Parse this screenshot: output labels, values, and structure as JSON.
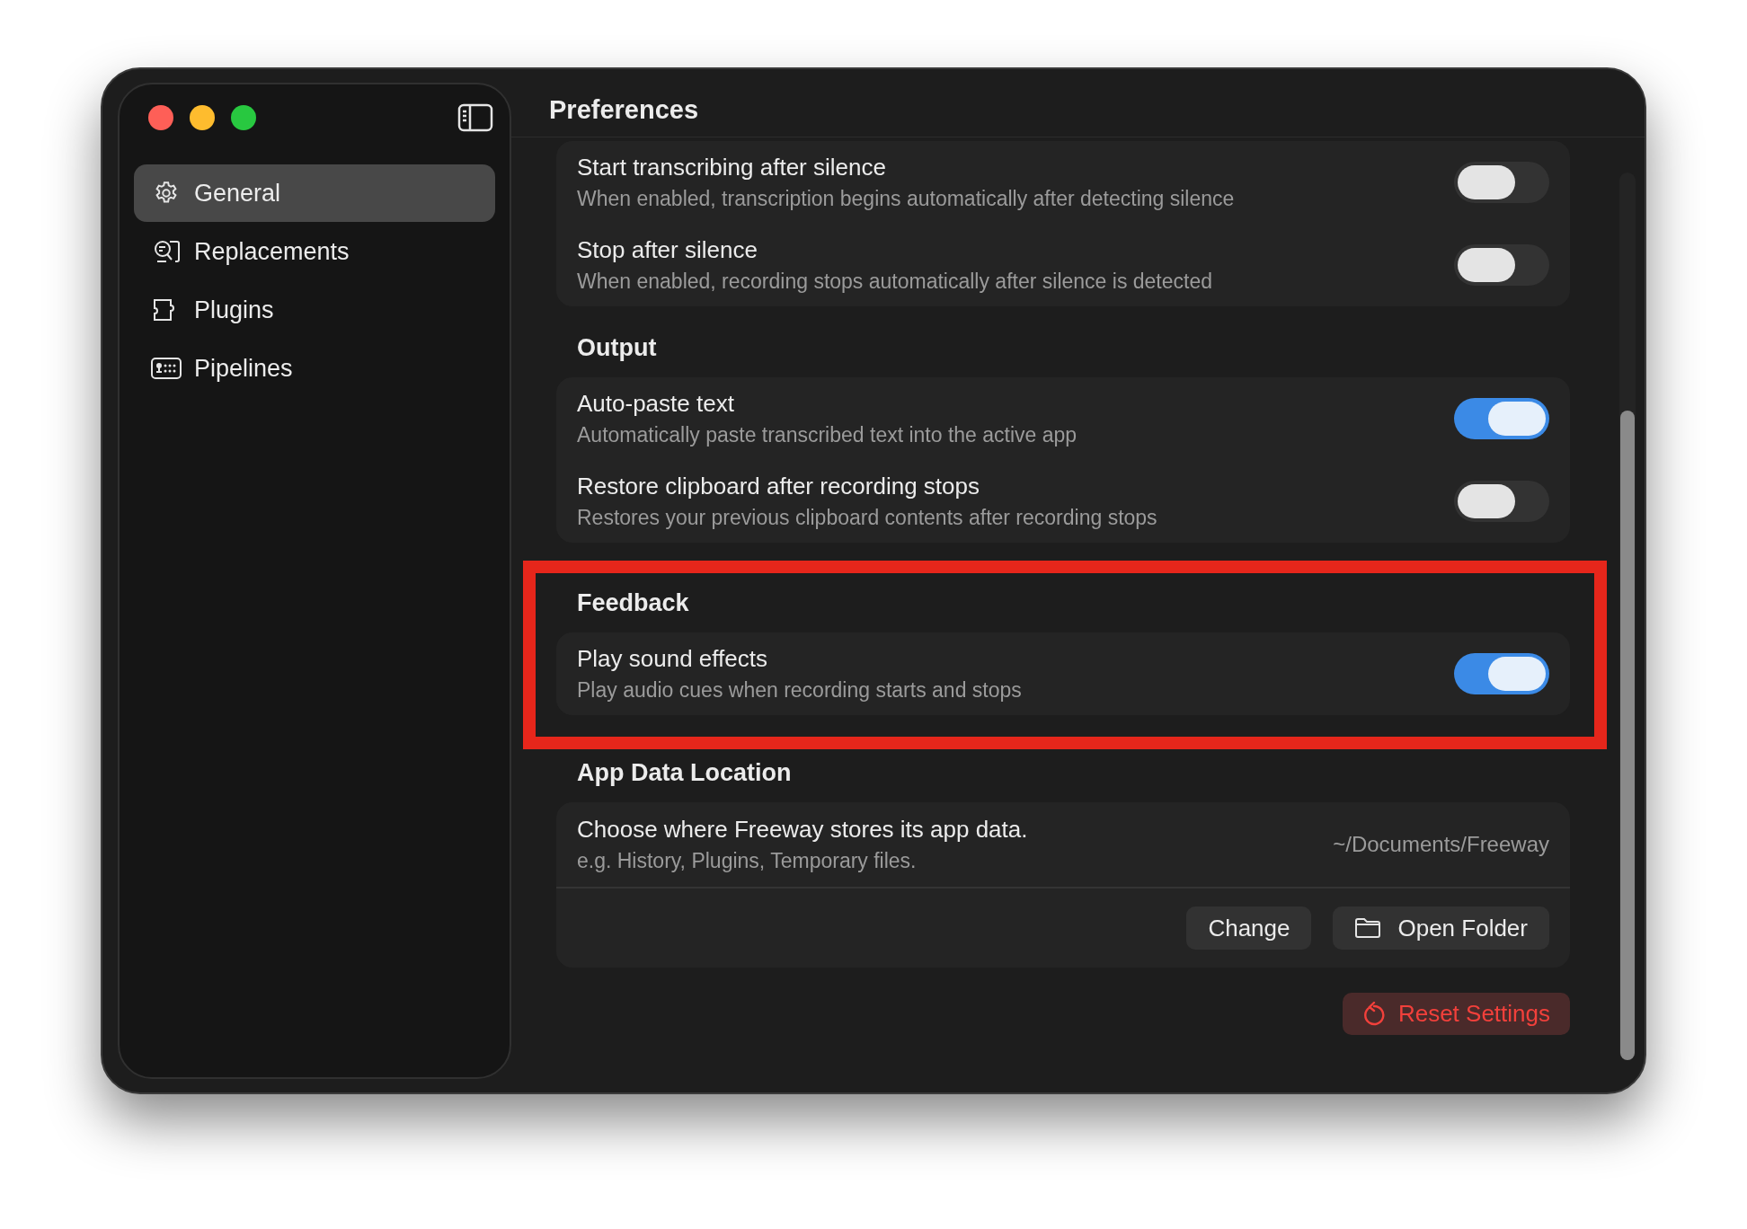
{
  "window": {
    "title": "Preferences"
  },
  "sidebar": {
    "items": [
      {
        "label": "General",
        "selected": true
      },
      {
        "label": "Replacements",
        "selected": false
      },
      {
        "label": "Plugins",
        "selected": false
      },
      {
        "label": "Pipelines",
        "selected": false
      }
    ]
  },
  "sections": [
    {
      "highlighted": false,
      "rows": [
        {
          "title": "Start transcribing after silence",
          "description": "When enabled, transcription begins automatically after detecting silence",
          "on": false
        },
        {
          "title": "Stop after silence",
          "description": "When enabled, recording stops automatically after silence is detected",
          "on": false
        }
      ]
    },
    {
      "heading": "Output",
      "highlighted": false,
      "rows": [
        {
          "title": "Auto-paste text",
          "description": "Automatically paste transcribed text into the active app",
          "on": true
        },
        {
          "title": "Restore clipboard after recording stops",
          "description": "Restores your previous clipboard contents after recording stops",
          "on": false
        }
      ]
    },
    {
      "heading": "Feedback",
      "highlighted": true,
      "rows": [
        {
          "title": "Play sound effects",
          "description": "Play audio cues when recording starts and stops",
          "on": true
        }
      ]
    }
  ],
  "app_data": {
    "heading": "App Data Location",
    "title": "Choose where Freeway stores its app data.",
    "description": "e.g. History, Plugins, Temporary files.",
    "path": "~/Documents/Freeway",
    "buttons": [
      {
        "label": "Change",
        "kind": "plain"
      },
      {
        "label": "Open Folder",
        "kind": "folder"
      }
    ]
  },
  "reset_button": "Reset Settings"
}
